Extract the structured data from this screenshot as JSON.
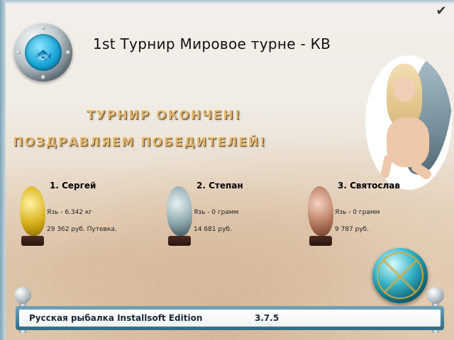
{
  "header": {
    "title": "1st Турнир Мировое турне - КВ",
    "close_icon": "checkmark-icon"
  },
  "banners": {
    "line1": "ТУРНИР ОКОНЧЕН!",
    "line2": "ПОЗДРАВЛЯЕМ ПОБЕДИТЕЛЕЙ!"
  },
  "winners": [
    {
      "place_name": "1. Сергей",
      "catch": "Язь - 6.342 кг",
      "prize": "29 362 руб. Путевка.",
      "trophy": "gold"
    },
    {
      "place_name": "2. Степан",
      "catch": "Язь - 0 грамм",
      "prize": "14 681 руб.",
      "trophy": "silver"
    },
    {
      "place_name": "3. Святослав",
      "catch": "Язь - 0 грамм",
      "prize": "9 787 руб.",
      "trophy": "bronze"
    }
  ],
  "footer": {
    "app_name": "Русская рыбалка Installsoft Edition",
    "version": "3.7.5"
  },
  "colors": {
    "banner_text": "#e0b978",
    "footer_frame": "#2f6a83",
    "gold": "#d8b21a",
    "silver": "#8ea7ad",
    "bronze": "#b67a5f"
  }
}
